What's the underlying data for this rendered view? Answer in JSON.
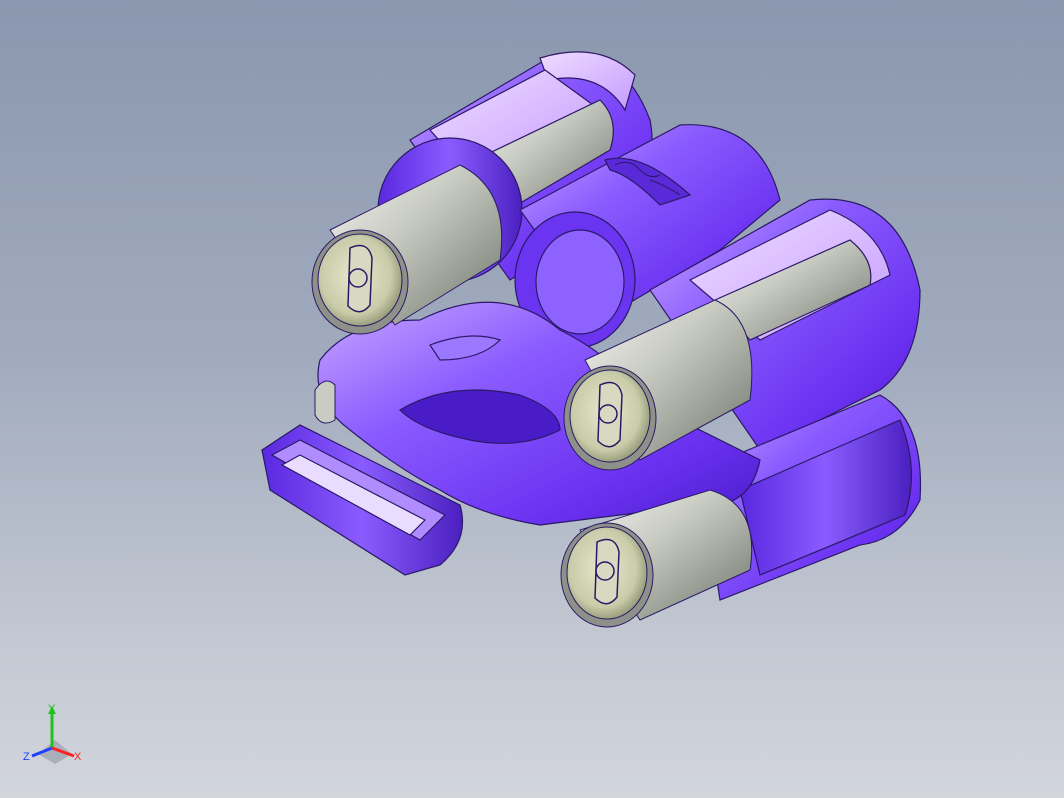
{
  "viewport": {
    "background_top": "#8a97ae",
    "background_bottom": "#d2d5dc"
  },
  "model": {
    "color": "#7b4dff",
    "edge_color": "#2a1a66",
    "can_color": "#bfc4bd",
    "lid_color": "#cdd1b0"
  },
  "triad": {
    "x_label": "X",
    "y_label": "Y",
    "z_label": "Z",
    "x_color": "#ff2020",
    "y_color": "#20c020",
    "z_color": "#2040ff"
  }
}
